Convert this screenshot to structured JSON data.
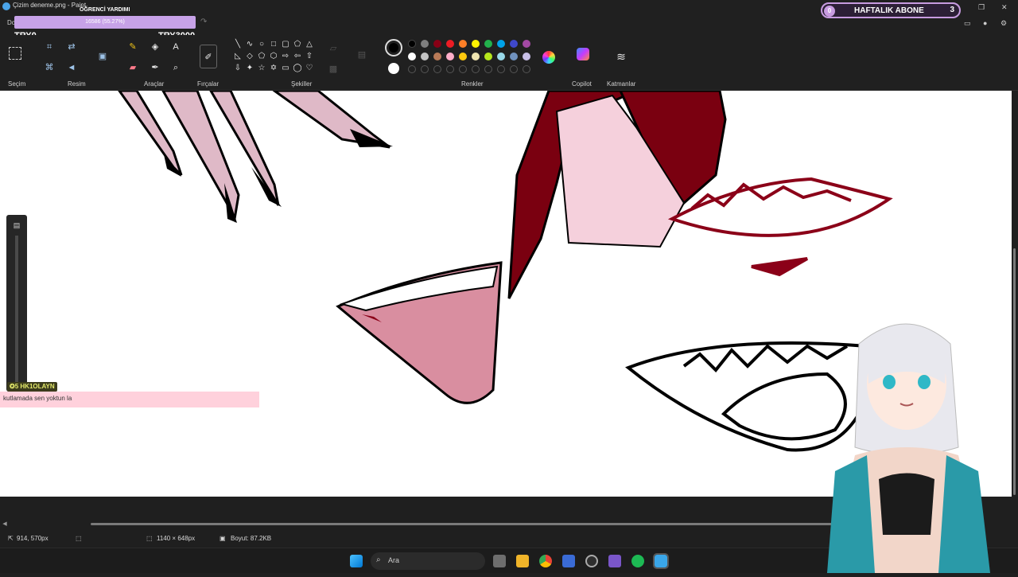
{
  "window": {
    "title": "Çizim deneme.png - Paint",
    "menu_first": "Dc"
  },
  "overlay": {
    "donation_label": "ÖĞRENCİ YARDIMI",
    "donation_value": "16586 (55.27%)",
    "try_min": "TRY0",
    "try_max": "TRY3000",
    "goal_current": "0",
    "goal_label": "HAFTALIK ABONE",
    "goal_target": "3",
    "chat_user": "HK1OLAYN",
    "chat_badge": "✪5",
    "chat_message": "kutlamada sen yoktun la"
  },
  "ribbon": {
    "groups": [
      {
        "label": "Seçim"
      },
      {
        "label": "Resim"
      },
      {
        "label": "Araçlar"
      },
      {
        "label": "Fırçalar"
      },
      {
        "label": "Şekiller"
      },
      {
        "label": "Renkler"
      },
      {
        "label": "Copilot"
      },
      {
        "label": "Katmanlar"
      }
    ],
    "colors_row1": [
      "#000000",
      "#7f7f7f",
      "#880015",
      "#ed1c24",
      "#ff7f27",
      "#fff200",
      "#22b14c",
      "#00a2e8",
      "#3f48cc",
      "#a349a4"
    ],
    "colors_row2": [
      "#ffffff",
      "#c3c3c3",
      "#b97a57",
      "#ffaec9",
      "#ffc90e",
      "#efe4b0",
      "#b5e61d",
      "#99d9ea",
      "#7092be",
      "#c8bfe7"
    ],
    "primary_color": "#000000",
    "secondary_color": "#ffffff"
  },
  "status": {
    "cursor": "914, 570px",
    "canvas_size": "1140 × 648px",
    "file_size": "Boyut: 87.2KB"
  },
  "taskbar": {
    "search_label": "Ara",
    "icons": [
      "windows-start-icon",
      "search-icon",
      "task-view-icon",
      "file-explorer-icon",
      "chrome-icon",
      "settings-icon",
      "obs-icon",
      "visual-studio-icon",
      "spotify-icon",
      "paint-icon"
    ]
  }
}
